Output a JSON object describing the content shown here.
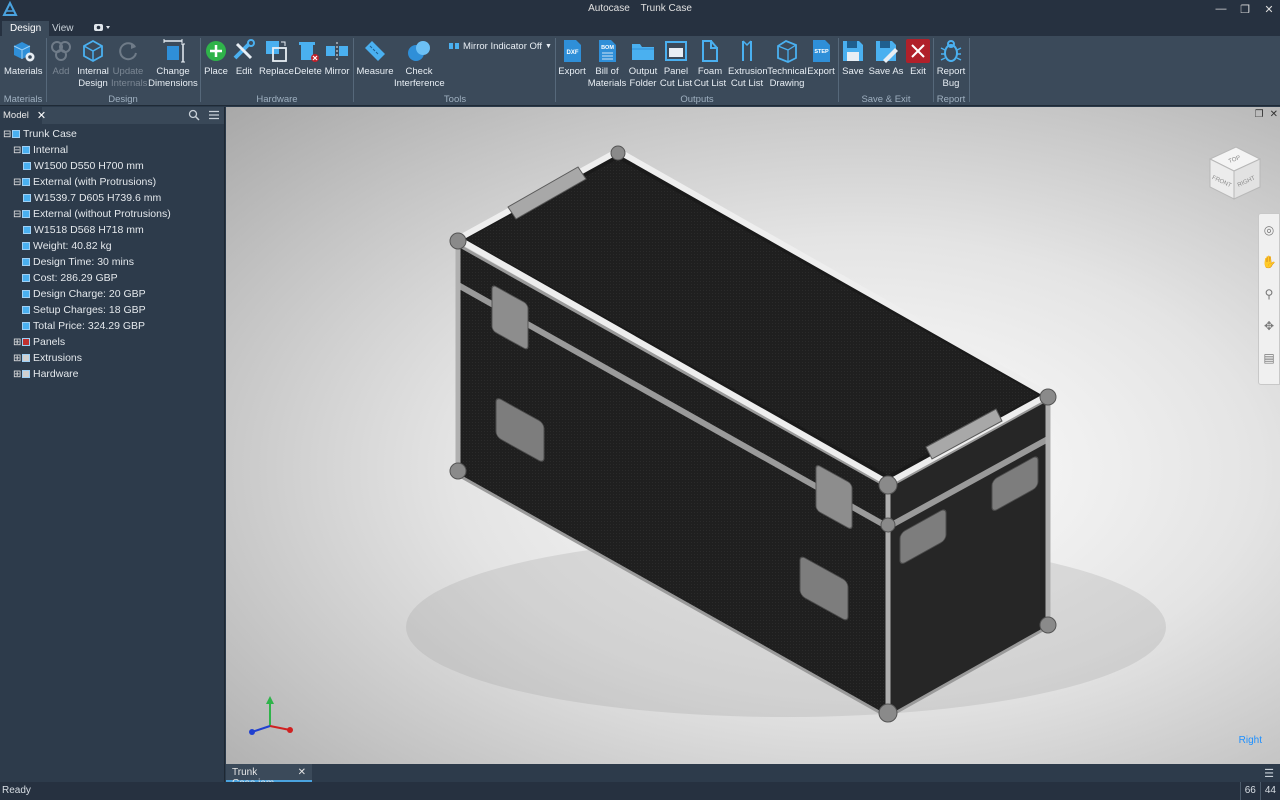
{
  "window": {
    "app_name": "Autocase",
    "doc_name": "Trunk Case"
  },
  "tabs": [
    {
      "label": "Design"
    },
    {
      "label": "View"
    }
  ],
  "ribbon": {
    "materials": {
      "label": "Materials",
      "group": "Materials"
    },
    "design": {
      "group": "Design",
      "add": "Add",
      "internal_design": [
        "Internal",
        "Design"
      ],
      "update_internals": [
        "Update",
        "Internals"
      ],
      "change_dimensions": [
        "Change",
        "Dimensions"
      ]
    },
    "hardware": {
      "group": "Hardware",
      "place": "Place",
      "edit": "Edit",
      "replace": "Replace",
      "delete": "Delete",
      "mirror": "Mirror"
    },
    "tools": {
      "group": "Tools",
      "measure": "Measure",
      "check_interference": [
        "Check",
        "Interference"
      ],
      "mirror_indicator": "Mirror Indicator Off"
    },
    "outputs": {
      "group": "Outputs",
      "export_dxf": "Export",
      "bill_of_materials": [
        "Bill of",
        "Materials"
      ],
      "output_folder": [
        "Output",
        "Folder"
      ],
      "panel_cut_list": [
        "Panel",
        "Cut List"
      ],
      "foam_cut_list": [
        "Foam",
        "Cut List"
      ],
      "extrusion_cut_list": [
        "Extrusion",
        "Cut List"
      ],
      "technical_drawing": [
        "Technical",
        "Drawing"
      ],
      "export_step": "Export",
      "icon_dxf": "DXF",
      "icon_bom": "BOM",
      "icon_step": "STEP"
    },
    "save_exit": {
      "group": "Save & Exit",
      "save": "Save",
      "save_as": "Save As",
      "exit": "Exit"
    },
    "report": {
      "group": "Report",
      "report_bug": [
        "Report",
        "Bug"
      ]
    }
  },
  "panel": {
    "tab": "Model",
    "tree": [
      {
        "label": "Trunk Case",
        "level": 0,
        "expander": "-"
      },
      {
        "label": "Internal",
        "level": 1,
        "expander": "-"
      },
      {
        "label": "W1500 D550 H700 mm",
        "level": 2,
        "expander": ""
      },
      {
        "label": "External (with Protrusions)",
        "level": 1,
        "expander": "-"
      },
      {
        "label": "W1539.7 D605 H739.6 mm",
        "level": 2,
        "expander": ""
      },
      {
        "label": "External (without Protrusions)",
        "level": 1,
        "expander": "-"
      },
      {
        "label": "W1518 D568 H718 mm",
        "level": 2,
        "expander": ""
      },
      {
        "label": "Weight: 40.82 kg",
        "level": 1,
        "expander": ""
      },
      {
        "label": "Design Time: 30 mins",
        "level": 1,
        "expander": ""
      },
      {
        "label": "Cost: 286.29 GBP",
        "level": 1,
        "expander": ""
      },
      {
        "label": "Design Charge: 20 GBP",
        "level": 1,
        "expander": ""
      },
      {
        "label": "Setup Charges: 18 GBP",
        "level": 1,
        "expander": ""
      },
      {
        "label": "Total Price: 324.29 GBP",
        "level": 1,
        "expander": ""
      },
      {
        "label": "Panels",
        "level": 1,
        "expander": "+"
      },
      {
        "label": "Extrusions",
        "level": 1,
        "expander": "+"
      },
      {
        "label": "Hardware",
        "level": 1,
        "expander": "+"
      }
    ]
  },
  "viewport": {
    "viewcube": {
      "top": "TOP",
      "front": "FRONT",
      "right": "RIGHT"
    },
    "orientation_label": "Right"
  },
  "doc_tab": "Trunk Case.iam",
  "status": {
    "text": "Ready",
    "num1": "66",
    "num2": "44"
  },
  "colors": {
    "accent": "#4aa3df",
    "ribbon_bg": "#3b4a5a",
    "panel_bg": "#2d3b4b",
    "exit_red": "#b0202a"
  }
}
